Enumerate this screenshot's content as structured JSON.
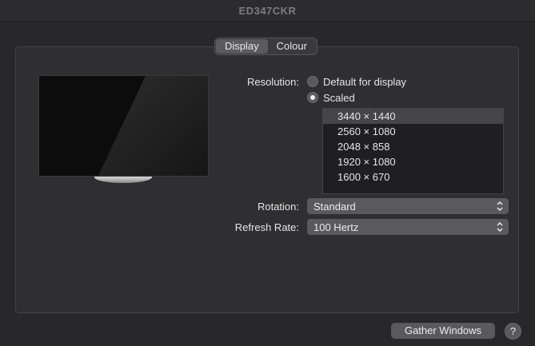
{
  "window": {
    "title": "ED347CKR"
  },
  "tabs": [
    {
      "label": "Display",
      "active": true
    },
    {
      "label": "Colour",
      "active": false
    }
  ],
  "resolution": {
    "label": "Resolution:",
    "options": [
      {
        "label": "Default for display",
        "checked": false
      },
      {
        "label": "Scaled",
        "checked": true
      }
    ],
    "list": [
      "3440 × 1440",
      "2560 × 1080",
      "2048 × 858",
      "1920 × 1080",
      "1600 × 670"
    ],
    "selected_index": 0
  },
  "rotation": {
    "label": "Rotation:",
    "value": "Standard"
  },
  "refresh_rate": {
    "label": "Refresh Rate:",
    "value": "100 Hertz"
  },
  "footer": {
    "gather_label": "Gather Windows",
    "help_label": "?"
  },
  "icons": {
    "chevron": "chevron-updown-icon",
    "monitor": "monitor-icon"
  },
  "colors": {
    "window_bg": "#2a2a2c",
    "control_bg": "#5a5a5d",
    "selected_row": "#464649"
  }
}
